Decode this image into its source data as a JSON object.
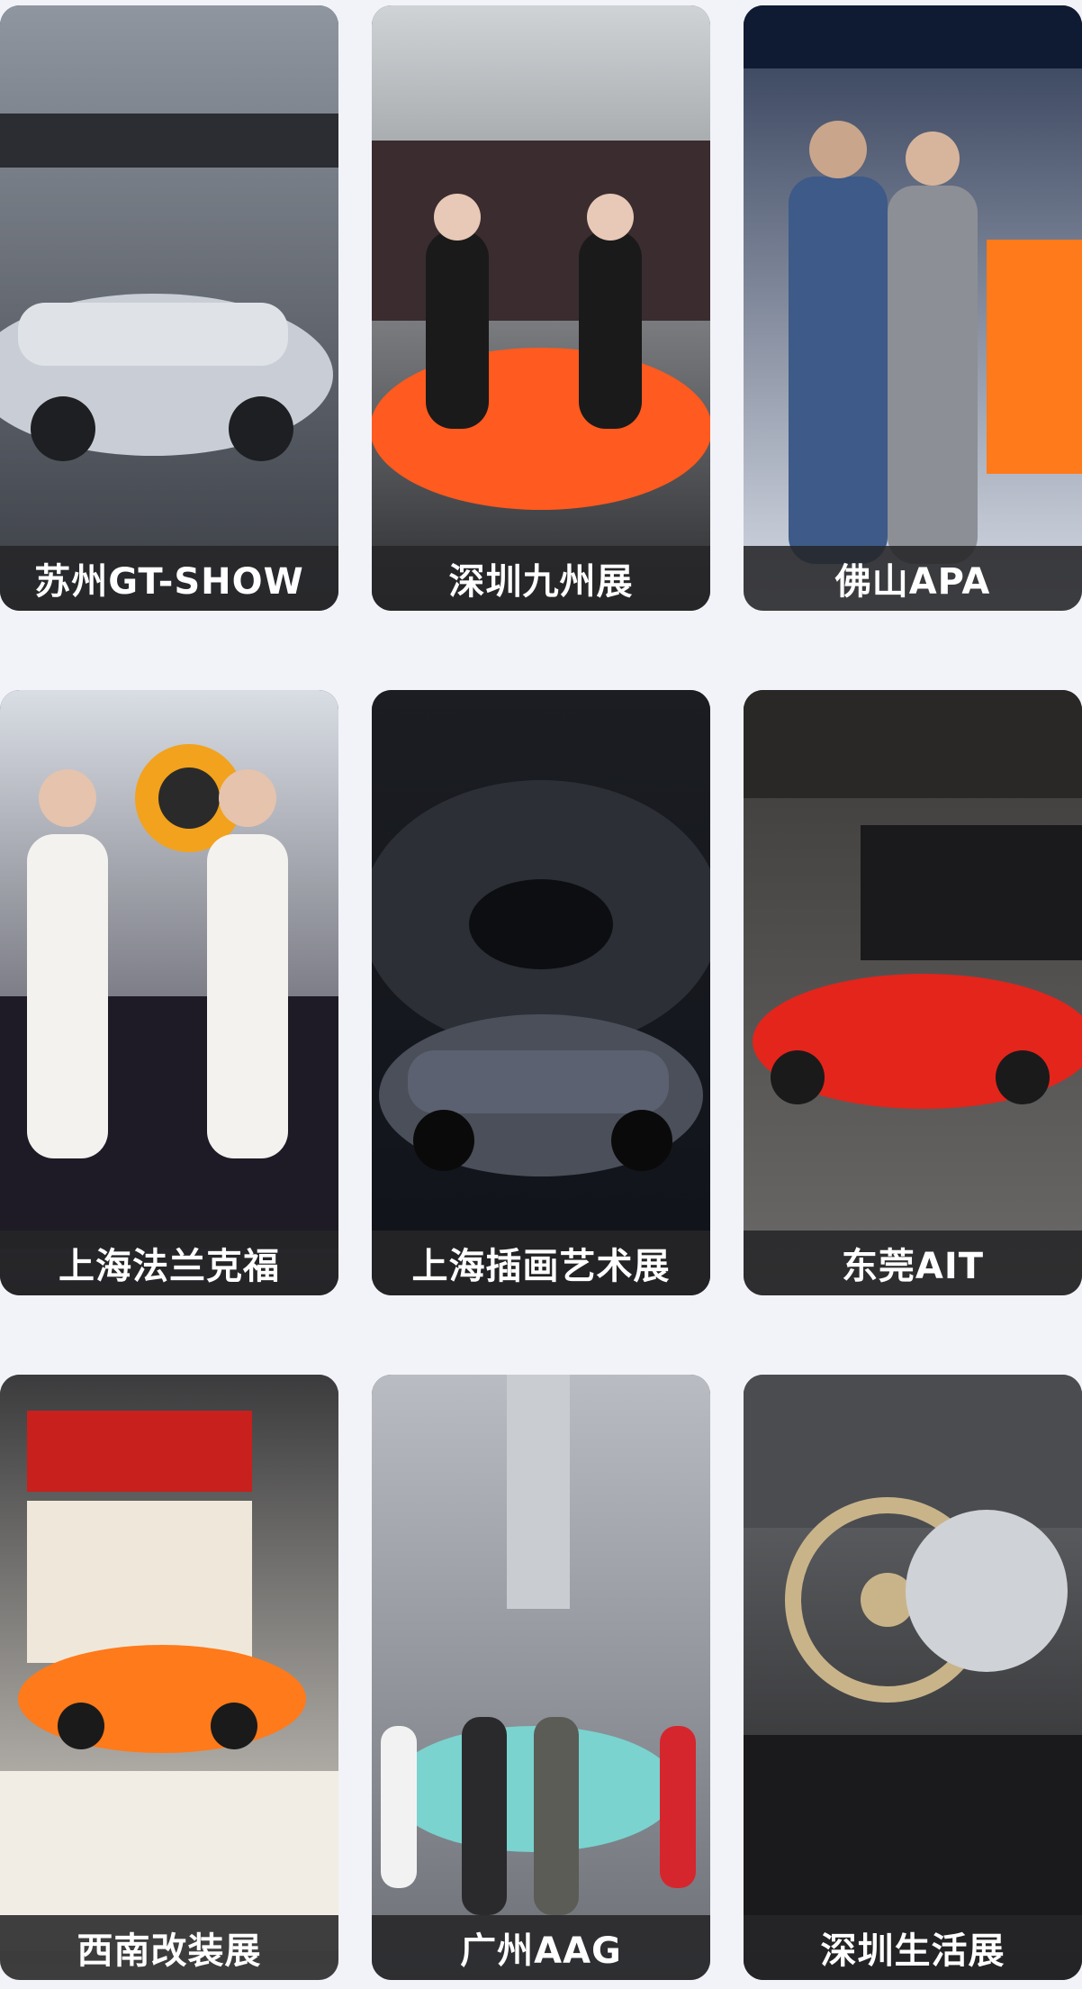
{
  "cards": [
    {
      "caption": "苏州GT-SHOW",
      "icon": "silver-gullwing-car-photo",
      "bg": [
        "#8f96a0",
        "#3a3d44"
      ],
      "accent": "#c9ced6"
    },
    {
      "caption": "深圳九州展",
      "icon": "orange-sports-car-models-photo",
      "bg": [
        "#cfd3d6",
        "#2b2b2e"
      ],
      "accent": "#ff5a1f"
    },
    {
      "caption": "佛山APA",
      "icon": "hosts-with-microphone-photo",
      "bg": [
        "#2e3a55",
        "#d8dde6"
      ],
      "accent": "#ff7a1a"
    },
    {
      "caption": "上海法兰克福",
      "icon": "brake-booth-models-photo",
      "bg": [
        "#d9dde4",
        "#23212c"
      ],
      "accent": "#f2a21c"
    },
    {
      "caption": "上海插画艺术展",
      "icon": "wrapped-bmw-tunnel-photo",
      "bg": [
        "#1b1d22",
        "#10131a"
      ],
      "accent": "#4a4f5a"
    },
    {
      "caption": "东莞AIT",
      "icon": "red-lotus-booth-photo",
      "bg": [
        "#3c3a38",
        "#6b6a69"
      ],
      "accent": "#e3251c"
    },
    {
      "caption": "西南改装展",
      "icon": "comic-orange-car-booth-photo",
      "bg": [
        "#3b3b3d",
        "#e9e4da"
      ],
      "accent": "#ff7a1a"
    },
    {
      "caption": "广州AAG",
      "icon": "teal-car-crowd-photo",
      "bg": [
        "#b9bcc2",
        "#6c6f76"
      ],
      "accent": "#7ad3cf"
    },
    {
      "caption": "深圳生活展",
      "icon": "gold-wheel-display-photo",
      "bg": [
        "#6c6e71",
        "#1c1c1e"
      ],
      "accent": "#c9b48a"
    }
  ]
}
